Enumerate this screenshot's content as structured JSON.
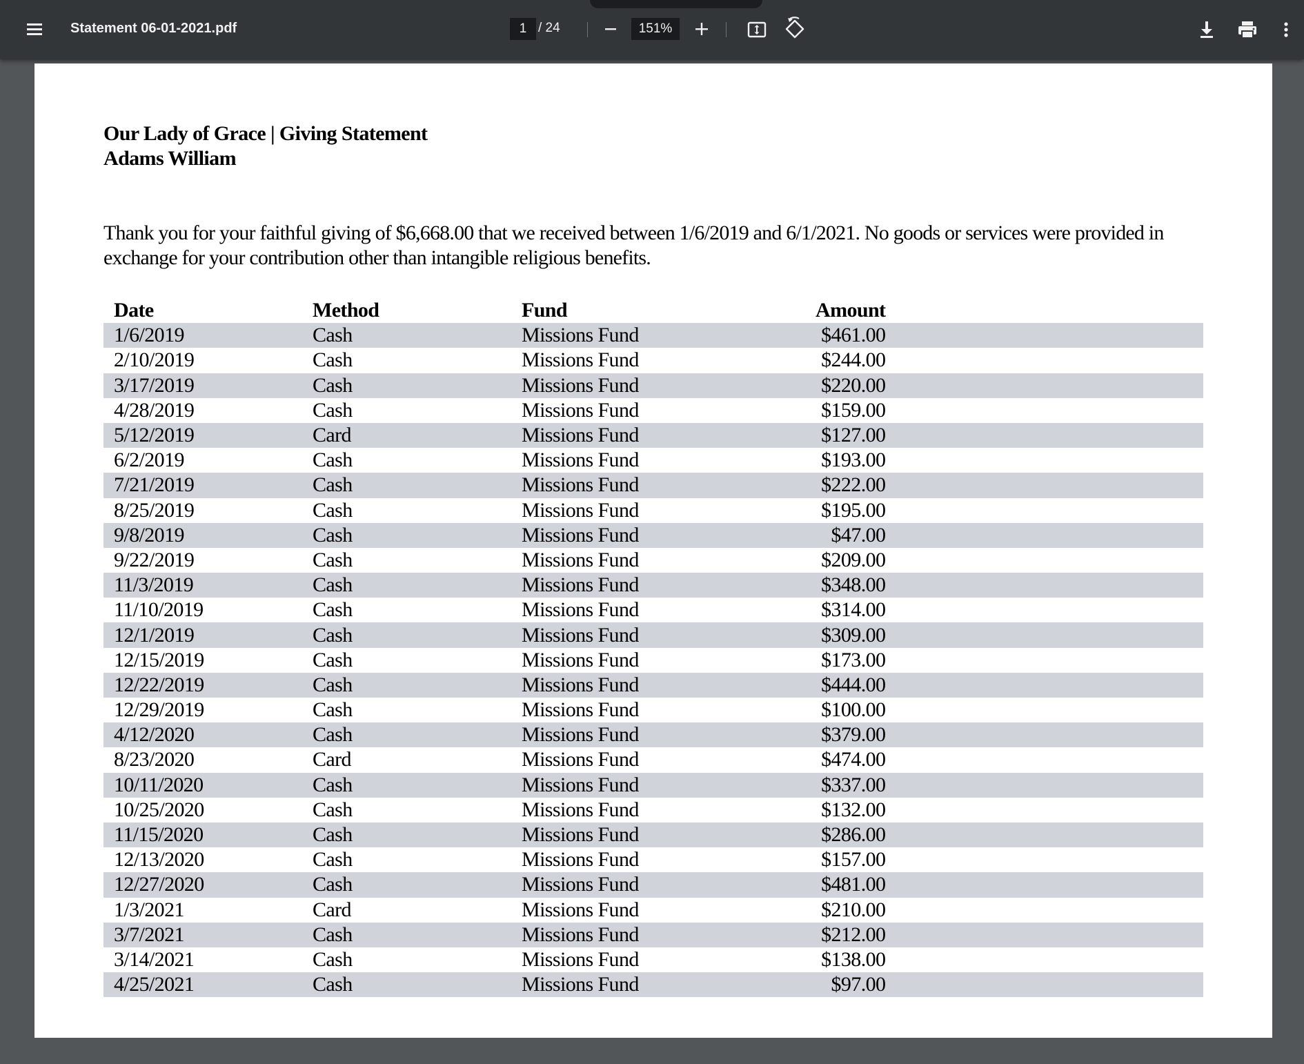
{
  "toolbar": {
    "file_name": "Statement 06-01-2021.pdf",
    "current_page": "1",
    "total_pages": "/ 24",
    "zoom": "151%",
    "icons": {
      "menu": "hamburger-menu-icon",
      "zoom_out": "minus-icon",
      "zoom_in": "plus-icon",
      "fit": "fit-to-page-icon",
      "rotate": "rotate-icon",
      "download": "download-icon",
      "print": "print-icon",
      "more": "more-vert-icon"
    }
  },
  "colors": {
    "toolbar_bg": "#323639",
    "viewer_bg": "#525659",
    "row_stripe": "#d0d3d9"
  },
  "document": {
    "heading_line1": "Our Lady of Grace | Giving Statement",
    "heading_line2": "Adams William",
    "intro": "Thank you for your faithful giving of  $6,668.00 that we received between 1/6/2019 and 6/1/2021. No goods or services were provided in exchange for your contribution other than intangible religious benefits.",
    "columns": {
      "date": "Date",
      "method": "Method",
      "fund": "Fund",
      "amount": "Amount"
    },
    "rows": [
      {
        "date": "1/6/2019",
        "method": "Cash",
        "fund": "Missions Fund",
        "amount": "$461.00"
      },
      {
        "date": "2/10/2019",
        "method": "Cash",
        "fund": "Missions Fund",
        "amount": "$244.00"
      },
      {
        "date": "3/17/2019",
        "method": "Cash",
        "fund": "Missions Fund",
        "amount": "$220.00"
      },
      {
        "date": "4/28/2019",
        "method": "Cash",
        "fund": "Missions Fund",
        "amount": "$159.00"
      },
      {
        "date": "5/12/2019",
        "method": "Card",
        "fund": "Missions Fund",
        "amount": "$127.00"
      },
      {
        "date": "6/2/2019",
        "method": "Cash",
        "fund": "Missions Fund",
        "amount": "$193.00"
      },
      {
        "date": "7/21/2019",
        "method": "Cash",
        "fund": "Missions Fund",
        "amount": "$222.00"
      },
      {
        "date": "8/25/2019",
        "method": "Cash",
        "fund": "Missions Fund",
        "amount": "$195.00"
      },
      {
        "date": "9/8/2019",
        "method": "Cash",
        "fund": "Missions Fund",
        "amount": "$47.00"
      },
      {
        "date": "9/22/2019",
        "method": "Cash",
        "fund": "Missions Fund",
        "amount": "$209.00"
      },
      {
        "date": "11/3/2019",
        "method": "Cash",
        "fund": "Missions Fund",
        "amount": "$348.00"
      },
      {
        "date": "11/10/2019",
        "method": "Cash",
        "fund": "Missions Fund",
        "amount": "$314.00"
      },
      {
        "date": "12/1/2019",
        "method": "Cash",
        "fund": "Missions Fund",
        "amount": "$309.00"
      },
      {
        "date": "12/15/2019",
        "method": "Cash",
        "fund": "Missions Fund",
        "amount": "$173.00"
      },
      {
        "date": "12/22/2019",
        "method": "Cash",
        "fund": "Missions Fund",
        "amount": "$444.00"
      },
      {
        "date": "12/29/2019",
        "method": "Cash",
        "fund": "Missions Fund",
        "amount": "$100.00"
      },
      {
        "date": "4/12/2020",
        "method": "Cash",
        "fund": "Missions Fund",
        "amount": "$379.00"
      },
      {
        "date": "8/23/2020",
        "method": "Card",
        "fund": "Missions Fund",
        "amount": "$474.00"
      },
      {
        "date": "10/11/2020",
        "method": "Cash",
        "fund": "Missions Fund",
        "amount": "$337.00"
      },
      {
        "date": "10/25/2020",
        "method": "Cash",
        "fund": "Missions Fund",
        "amount": "$132.00"
      },
      {
        "date": "11/15/2020",
        "method": "Cash",
        "fund": "Missions Fund",
        "amount": "$286.00"
      },
      {
        "date": "12/13/2020",
        "method": "Cash",
        "fund": "Missions Fund",
        "amount": "$157.00"
      },
      {
        "date": "12/27/2020",
        "method": "Cash",
        "fund": "Missions Fund",
        "amount": "$481.00"
      },
      {
        "date": "1/3/2021",
        "method": "Card",
        "fund": "Missions Fund",
        "amount": "$210.00"
      },
      {
        "date": "3/7/2021",
        "method": "Cash",
        "fund": "Missions Fund",
        "amount": "$212.00"
      },
      {
        "date": "3/14/2021",
        "method": "Cash",
        "fund": "Missions Fund",
        "amount": "$138.00"
      },
      {
        "date": "4/25/2021",
        "method": "Cash",
        "fund": "Missions Fund",
        "amount": "$97.00"
      }
    ]
  }
}
